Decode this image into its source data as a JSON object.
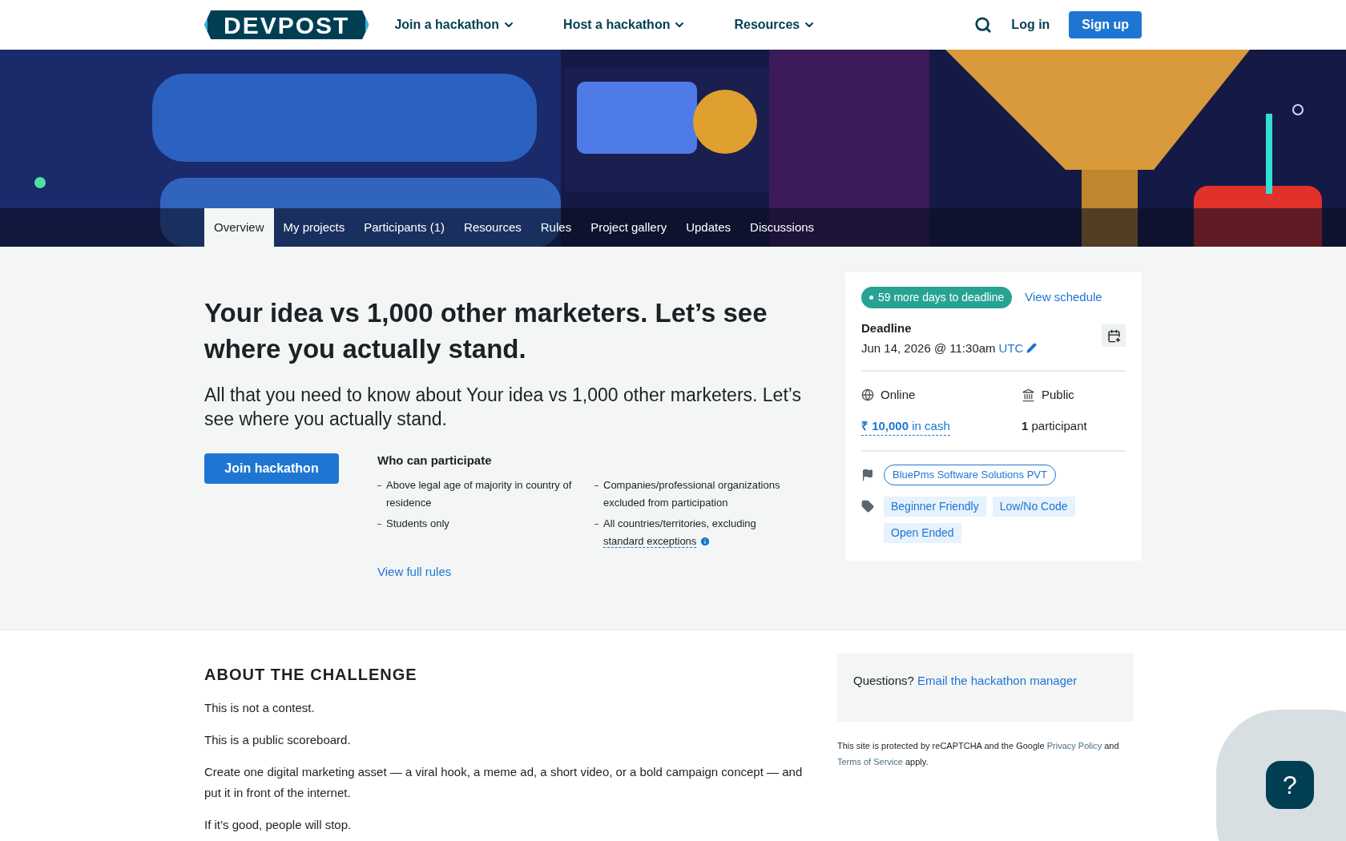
{
  "header": {
    "logo": "DEVPOST",
    "nav": [
      {
        "label": "Join a hackathon"
      },
      {
        "label": "Host a hackathon"
      },
      {
        "label": "Resources"
      }
    ],
    "login": "Log in",
    "signup": "Sign up"
  },
  "tabs": [
    {
      "label": "Overview",
      "selected": true
    },
    {
      "label": "My projects",
      "selected": false
    },
    {
      "label": "Participants (1)",
      "selected": false
    },
    {
      "label": "Resources",
      "selected": false
    },
    {
      "label": "Rules",
      "selected": false
    },
    {
      "label": "Project gallery",
      "selected": false
    },
    {
      "label": "Updates",
      "selected": false
    },
    {
      "label": "Discussions",
      "selected": false
    }
  ],
  "hero": {
    "title": "Your idea vs 1,000 other marketers. Let’s see where you actually stand.",
    "subtitle": "All that you need to know about Your idea vs 1,000 other marketers. Let’s see where you actually stand.",
    "join_button": "Join hackathon",
    "eligibility": {
      "heading": "Who can participate",
      "columns": [
        [
          {
            "text": "Above legal age of majority in country of residence"
          },
          {
            "text": "Students only"
          }
        ],
        [
          {
            "text": "Companies/professional organizations excluded from participation"
          },
          {
            "text": "All countries/territories, excluding",
            "link": "standard exceptions"
          }
        ]
      ]
    },
    "rules_link": "View full rules"
  },
  "sidebar": {
    "status_badge": "59 more days to deadline",
    "schedule_link": "View schedule",
    "deadline_label": "Deadline",
    "deadline_date": "Jun 14, 2026 @ 11:30am",
    "timezone": "UTC",
    "location": "Online",
    "visibility": "Public",
    "prize": "**₹ 10,000** in cash",
    "participants": "**1** participant",
    "host": "BluePms Software Solutions PVT",
    "tags": [
      "Beginner Friendly",
      "Low/No Code",
      "Open Ended"
    ]
  },
  "about": {
    "heading": "ABOUT THE CHALLENGE",
    "paragraphs": [
      "This is not a contest.",
      "This is a public scoreboard.",
      "Create one digital marketing asset — a viral hook, a meme ad, a short video, or a bold campaign concept — and put it in front of the internet.",
      "If it’s good, people will stop."
    ]
  },
  "questions": {
    "prefix": "Questions?",
    "link": "Email the hackathon manager"
  },
  "recaptcha": {
    "text_1": "This site is protected by reCAPTCHA and the Google",
    "privacy_link": "Privacy Policy",
    "text_2": "and",
    "terms_link": "Terms of Service",
    "text_3": "apply."
  },
  "help_button": "?"
}
